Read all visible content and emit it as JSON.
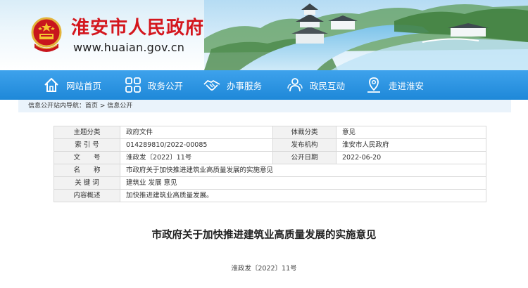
{
  "site": {
    "name": "淮安市人民政府",
    "url": "www.huaian.gov.cn",
    "emblem_icon": "national-emblem-icon",
    "brand_color": "#d4161d"
  },
  "nav": {
    "bg_color": "#2a94e2",
    "items": [
      {
        "label": "网站首页",
        "icon": "home-icon"
      },
      {
        "label": "政务公开",
        "icon": "grid-icon"
      },
      {
        "label": "办事服务",
        "icon": "handshake-icon"
      },
      {
        "label": "政民互动",
        "icon": "people-icon"
      },
      {
        "label": "走进淮安",
        "icon": "map-pin-icon"
      }
    ]
  },
  "breadcrumb": {
    "prefix": "信息公开站内导航：",
    "items": [
      "首页",
      "信息公开"
    ],
    "separator": " > "
  },
  "info_table": {
    "subject_category_label": "主题分类",
    "subject_category_value": "政府文件",
    "genre_label": "体裁分类",
    "genre_value": "意见",
    "index_no_label": "索 引 号",
    "index_no_value": "014289810/2022-00085",
    "issuer_label": "发布机构",
    "issuer_value": "淮安市人民政府",
    "doc_no_label": "文　　号",
    "doc_no_value": "淮政发〔2022〕11号",
    "date_label": "公开日期",
    "date_value": "2022-06-20",
    "name_label": "名　　称",
    "name_value": "市政府关于加快推进建筑业高质量发展的实施意见",
    "keywords_label": "关 键 词",
    "keywords_value": "建筑业 发展 意见",
    "summary_label": "内容概述",
    "summary_value": "加快推进建筑业高质量发展。"
  },
  "article": {
    "title": "市政府关于加快推进建筑业高质量发展的实施意见",
    "doc_no": "淮政发〔2022〕11号"
  }
}
